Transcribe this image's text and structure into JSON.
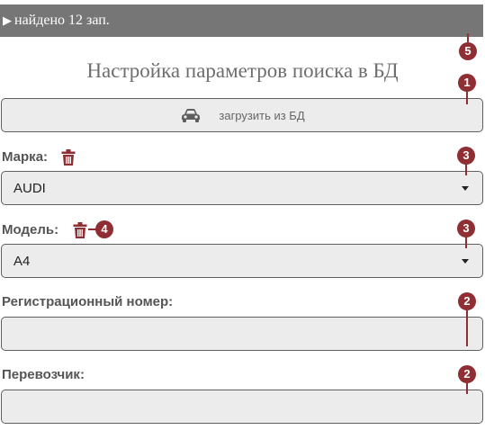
{
  "status_bar": {
    "arrow": "▶",
    "text": "найдено 12 зап."
  },
  "page_title": "Настройка параметров поиска в БД",
  "load_button": {
    "label": "загрузить из БД",
    "icon": "car-icon"
  },
  "fields": {
    "brand": {
      "label": "Марка:",
      "value": "AUDI",
      "icon": "trash-icon"
    },
    "model": {
      "label": "Модель:",
      "value": "A4",
      "icon": "trash-icon"
    },
    "reg_number": {
      "label": "Регистрационный номер:",
      "value": ""
    },
    "carrier": {
      "label": "Перевозчик:",
      "value": ""
    }
  },
  "badges": {
    "status_bar": "5",
    "load_button": "1",
    "brand_select": "3",
    "model_trash": "4",
    "model_select": "3",
    "reg_number": "2",
    "carrier": "2"
  },
  "colors": {
    "status_bar_bg": "#767676",
    "badge": "#8f2f33",
    "trash_icon": "#8f2f33",
    "field_bg": "#ececec"
  }
}
